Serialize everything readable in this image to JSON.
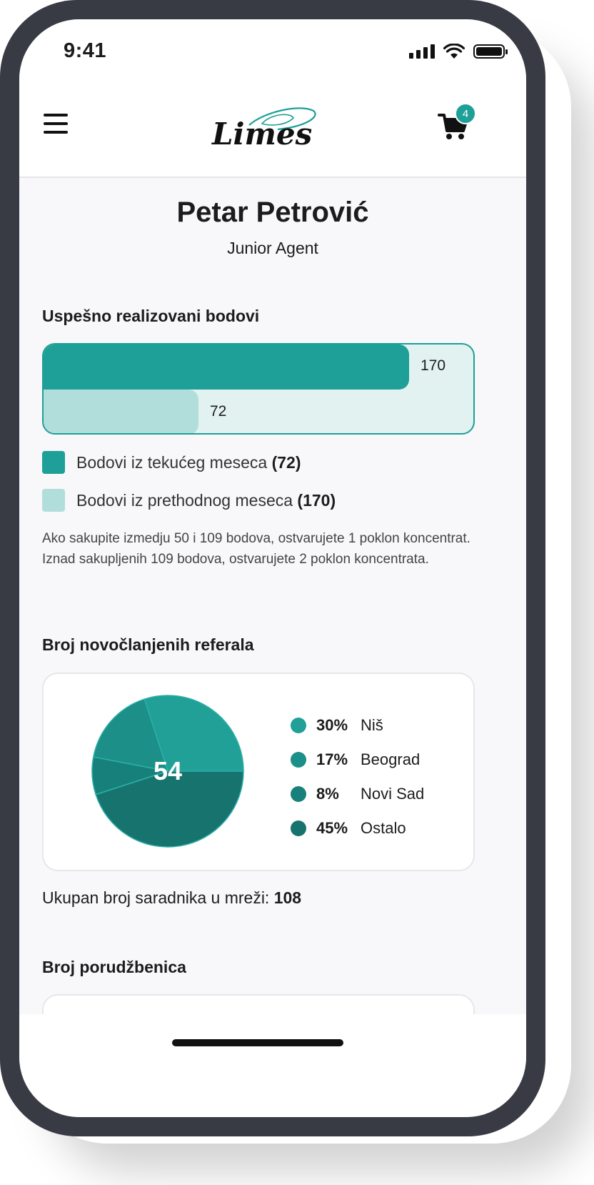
{
  "status_bar": {
    "time": "9:41"
  },
  "header": {
    "logo_text": "Limes",
    "cart_count": "4",
    "icons": {
      "menu": "hamburger-icon",
      "cart": "cart-icon"
    }
  },
  "profile": {
    "name": "Petar Petrović",
    "role": "Junior Agent"
  },
  "points": {
    "title": "Uspešno realizovani bodovi",
    "prev_month_value": "170",
    "current_month_value": "72",
    "max_value": 200,
    "legend_current": {
      "label": "Bodovi iz tekućeg meseca",
      "value": "(72)"
    },
    "legend_prev": {
      "label": "Bodovi iz prethodnog meseca",
      "value": "(170)"
    },
    "note": "Ako sakupite izmedju 50 i 109 bodova, ostvarujete 1 poklon koncentrat. Iznad sakupljenih 109 bodova, ostvarujete 2 poklon koncentrata.",
    "colors": {
      "prev": "#1e9f97",
      "current": "#b1dedb",
      "track": "#e1f2f1"
    }
  },
  "referrals": {
    "title": "Broj novočlanjenih referala",
    "total": "54",
    "slices": [
      {
        "pct": "30%",
        "city": "Niš",
        "value": 30,
        "color": "#21a098"
      },
      {
        "pct": "17%",
        "city": "Beograd",
        "value": 17,
        "color": "#1b8f88"
      },
      {
        "pct": "8%",
        "city": "Novi Sad",
        "value": 8,
        "color": "#18807a"
      },
      {
        "pct": "45%",
        "city": "Ostalo",
        "value": 45,
        "color": "#17736e"
      }
    ],
    "network_label": "Ukupan broj saradnika u mreži:",
    "network_value": "108"
  },
  "orders": {
    "title": "Broj porudžbenica"
  }
}
